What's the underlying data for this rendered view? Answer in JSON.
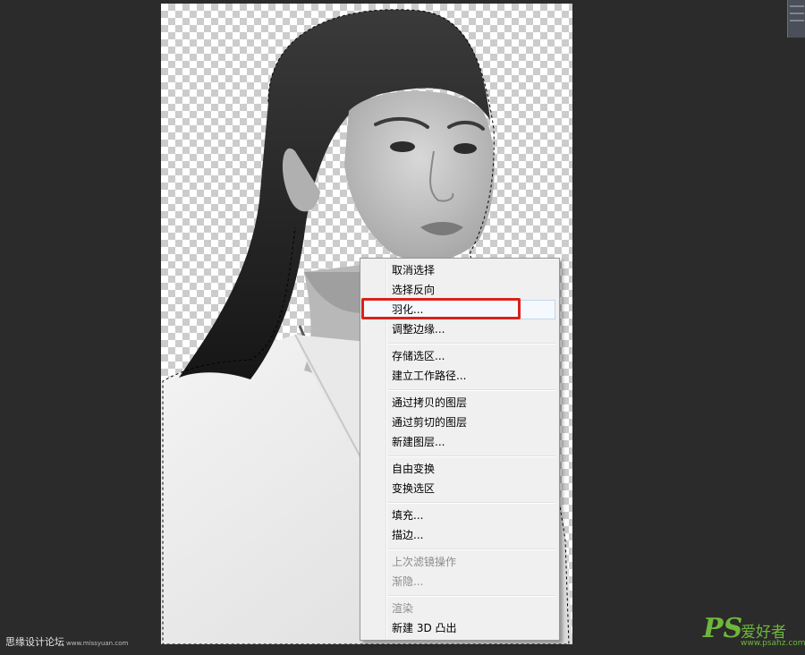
{
  "context_menu": {
    "items": [
      {
        "label": "取消选择",
        "enabled": true
      },
      {
        "label": "选择反向",
        "enabled": true
      },
      {
        "label": "羽化...",
        "enabled": true,
        "highlighted": true
      },
      {
        "label": "调整边缘...",
        "enabled": true
      },
      {
        "label": "存储选区...",
        "enabled": true
      },
      {
        "label": "建立工作路径...",
        "enabled": true
      },
      {
        "label": "通过拷贝的图层",
        "enabled": true
      },
      {
        "label": "通过剪切的图层",
        "enabled": true
      },
      {
        "label": "新建图层...",
        "enabled": true
      },
      {
        "label": "自由变换",
        "enabled": true
      },
      {
        "label": "变换选区",
        "enabled": true
      },
      {
        "label": "填充...",
        "enabled": true
      },
      {
        "label": "描边...",
        "enabled": true
      },
      {
        "label": "上次滤镜操作",
        "enabled": false
      },
      {
        "label": "渐隐...",
        "enabled": false
      },
      {
        "label": "渲染",
        "enabled": false
      },
      {
        "label": "新建 3D 凸出",
        "enabled": true
      }
    ]
  },
  "canvas": {
    "content": "portrait-photo",
    "background": "transparency-checkerboard"
  },
  "watermarks": {
    "left_text": "思缘设计论坛",
    "left_url": "www.missyuan.com",
    "right_logo": "PS",
    "right_title": "爱好者",
    "right_url": "www.psahz.com"
  },
  "colors": {
    "highlight_box": "#d9221a",
    "workspace": "#2b2b2b",
    "menu_bg": "#f0f0f0",
    "watermark": "#6fb73a"
  }
}
